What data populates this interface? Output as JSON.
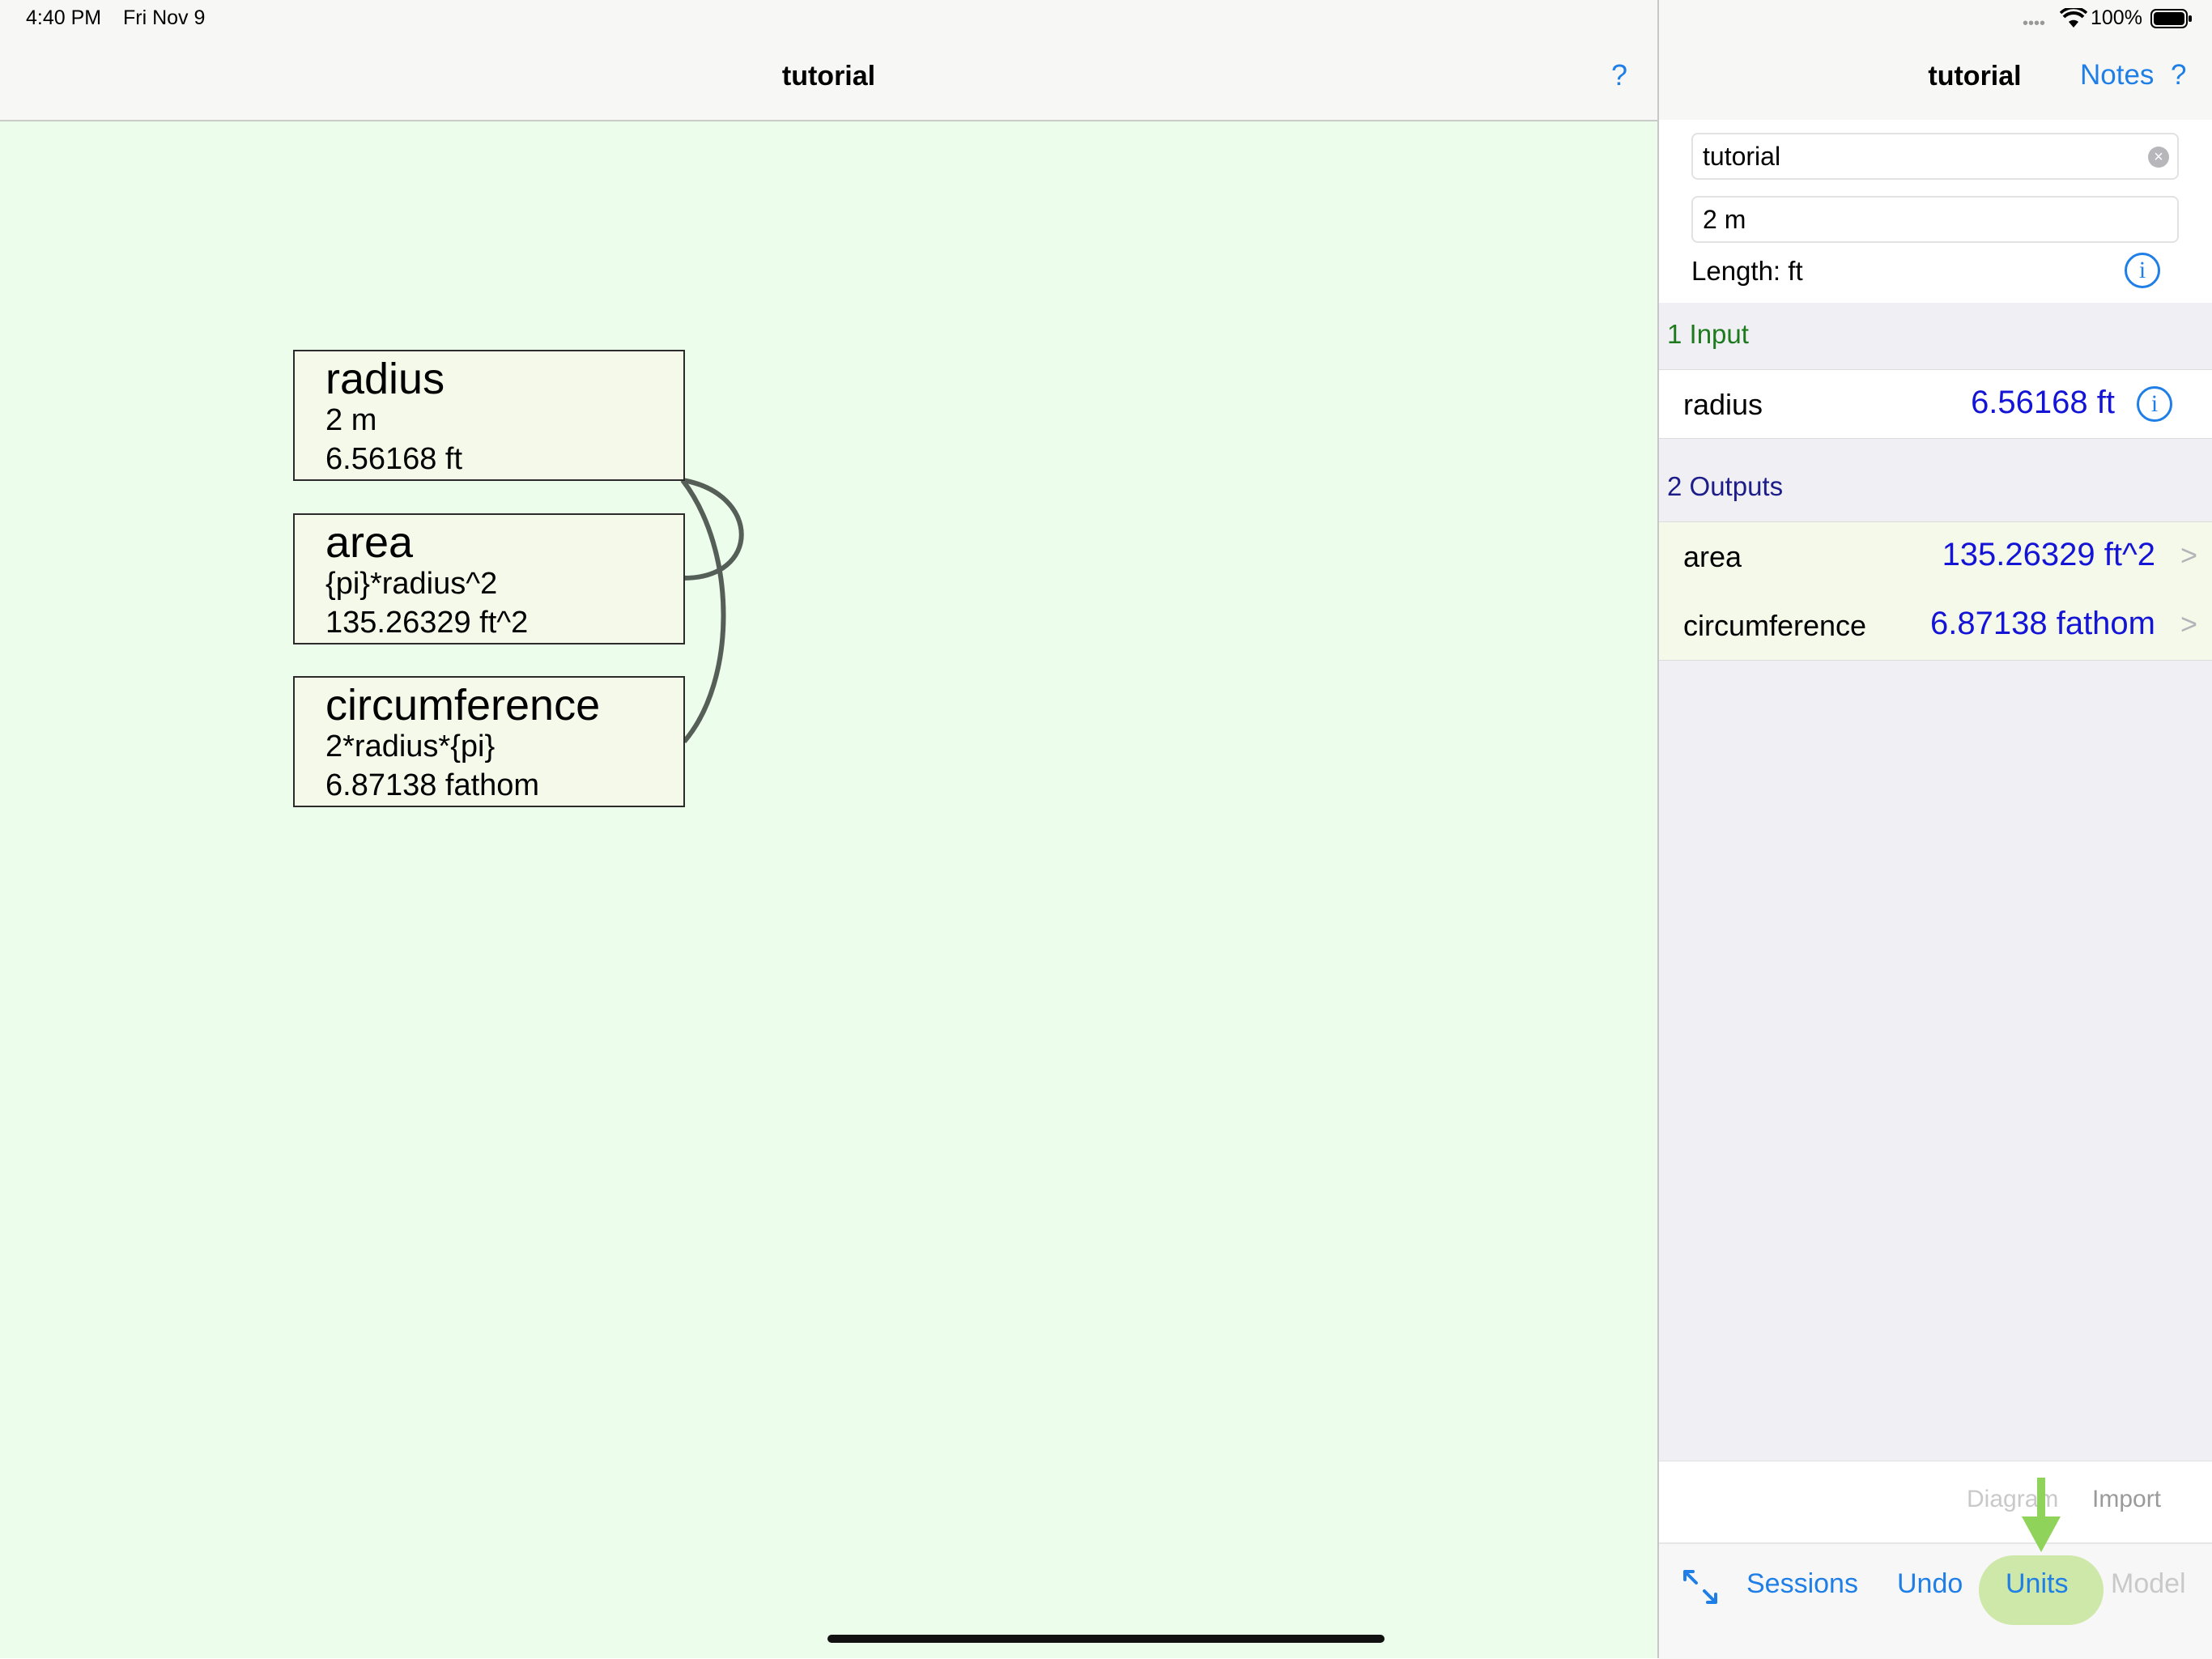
{
  "status_bar": {
    "time": "4:40 PM",
    "date": "Fri Nov 9",
    "battery_percent": "100%"
  },
  "left_pane": {
    "title": "tutorial",
    "help_label": "?",
    "background_color": "#edfdeb",
    "nodes": [
      {
        "name": "radius",
        "line2": "2 m",
        "line3": "6.56168 ft"
      },
      {
        "name": "area",
        "line2": "{pi}*radius^2",
        "line3": "135.26329 ft^2"
      },
      {
        "name": "circumference",
        "line2": "2*radius*{pi}",
        "line3": "6.87138 fathom"
      }
    ]
  },
  "right_pane": {
    "title": "tutorial",
    "notes_label": "Notes",
    "help_label": "?",
    "name_field_value": "tutorial",
    "value_field_value": "2 m",
    "unit_label": "Length: ft",
    "inputs_header": "1 Input",
    "inputs": [
      {
        "name": "radius",
        "value": "6.56168 ft"
      }
    ],
    "outputs_header": "2 Outputs",
    "outputs": [
      {
        "name": "area",
        "value": "135.26329 ft^2"
      },
      {
        "name": "circumference",
        "value": "6.87138 fathom"
      }
    ],
    "secondary_toolbar": {
      "diagram_label": "Diagram",
      "import_label": "Import"
    },
    "toolbar": {
      "expand_icon": "expand-arrows-icon",
      "sessions_label": "Sessions",
      "undo_label": "Undo",
      "units_label": "Units",
      "model_label": "Model"
    },
    "accent_color": "#1f7fe6",
    "value_color": "#1414d6",
    "highlight_color": "#cde8a8"
  }
}
